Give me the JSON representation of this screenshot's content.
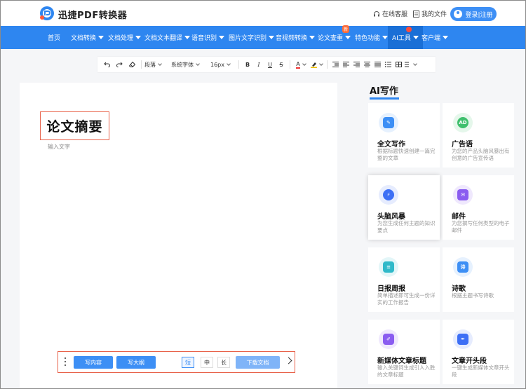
{
  "header": {
    "brand": "迅捷PDF转换器",
    "service": "在线客服",
    "my_files": "我的文件",
    "login": "登录|注册"
  },
  "nav": {
    "items": [
      {
        "label": "首页",
        "has_caret": false
      },
      {
        "label": "文档转换",
        "has_caret": true
      },
      {
        "label": "文档处理",
        "has_caret": true
      },
      {
        "label": "文档文本翻译",
        "has_caret": true
      },
      {
        "label": "语音识别",
        "has_caret": true
      },
      {
        "label": "图片文字识别",
        "has_caret": true
      },
      {
        "label": "音视频转换",
        "has_caret": true
      },
      {
        "label": "论文查重",
        "has_caret": true,
        "badge": "新"
      },
      {
        "label": "特色功能",
        "has_caret": true
      },
      {
        "label": "AI工具",
        "has_caret": true,
        "active": true,
        "dot": true
      },
      {
        "label": "客户端",
        "has_caret": true
      }
    ]
  },
  "toolbar": {
    "paragraph": "段落",
    "font": "系统字体",
    "size": "16px",
    "bold": "B",
    "italic": "I",
    "underline": "U",
    "strike": "S",
    "font_color": "A"
  },
  "editor": {
    "title": "论文摘要",
    "placeholder": "输入文字"
  },
  "bottom_bar": {
    "write_content": "写内容",
    "write_outline": "写大纲",
    "short": "短",
    "medium": "中",
    "long": "长",
    "download": "下载文档"
  },
  "ai_panel": {
    "title": "AI写作",
    "cards": [
      {
        "title": "全文写作",
        "desc": "根据标题快速创建一篇完整的文章",
        "icon": "document-edit-icon",
        "color": "#3d8ff5",
        "bg": "#e6f1fe"
      },
      {
        "title": "广告语",
        "desc": "为您的产品头脑风暴出有创意的广告宣传语",
        "icon": "ad-icon",
        "color": "#3fbf6d",
        "bg": "#e5f7eb",
        "text": "AD"
      },
      {
        "title": "头脑风暴",
        "desc": "为您生成任何主题的知识要点",
        "icon": "lightning-icon",
        "color": "#3d6ff5",
        "bg": "#e6ecfe"
      },
      {
        "title": "邮件",
        "desc": "为您撰写任何类型的电子邮件",
        "icon": "envelope-icon",
        "color": "#8a5cf0",
        "bg": "#efe8fd"
      },
      {
        "title": "日报周报",
        "desc": "简单描述即可生成一份详实的工作报告",
        "icon": "report-icon",
        "color": "#2fb9c9",
        "bg": "#e3f6f8"
      },
      {
        "title": "诗歌",
        "desc": "根据主题书写诗歌",
        "icon": "poem-icon",
        "color": "#3d8ff5",
        "bg": "#e6f1fe",
        "text": "诗"
      },
      {
        "title": "新媒体文章标题",
        "desc": "输入关键词生成引人入胜的文章标题",
        "icon": "pen-icon",
        "color": "#8a5cf0",
        "bg": "#efe8fd"
      },
      {
        "title": "文章开头段",
        "desc": "一键生成新媒体文章开头段",
        "icon": "quill-icon",
        "color": "#3d6ff5",
        "bg": "#e6ecfe"
      }
    ]
  }
}
